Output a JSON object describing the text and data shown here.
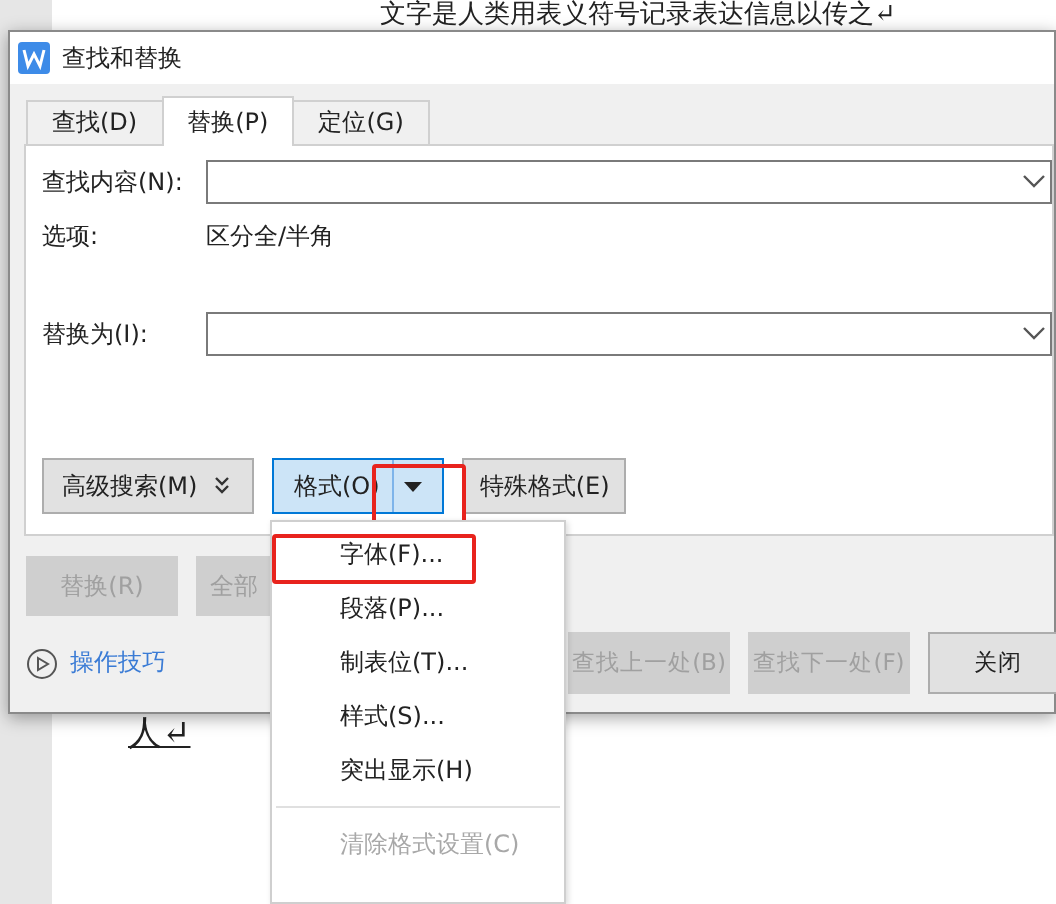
{
  "document": {
    "lines": [
      "文字是人类用表义符号记录表达信息以传之↵",
      "人↵"
    ]
  },
  "dialog": {
    "title": "查找和替换",
    "tabs": [
      {
        "label": "查找(D)",
        "selected": false
      },
      {
        "label": "替换(P)",
        "selected": true
      },
      {
        "label": "定位(G)",
        "selected": false
      }
    ],
    "find_label": "查找内容(N):",
    "options_label": "选项:",
    "options_value": "区分全/半角",
    "replace_label": "替换为(I):",
    "advanced_button": "高级搜索(M)",
    "format_button": {
      "label": "格式(O)",
      "highlighted": true,
      "expanded": true
    },
    "special_button": "特殊格式(E)",
    "action_buttons": [
      {
        "label": "替换(R)",
        "disabled": true
      },
      {
        "label": "全部",
        "disabled": true
      }
    ],
    "tips_link": "操作技巧",
    "nav_buttons": [
      {
        "label": "查找上一处(B)",
        "disabled": true
      },
      {
        "label": "查找下一处(F)",
        "disabled": true
      },
      {
        "label": "关闭",
        "disabled": false
      }
    ]
  },
  "format_menu": {
    "items": [
      {
        "label": "字体(F)...",
        "disabled": false,
        "highlighted": true
      },
      {
        "label": "段落(P)...",
        "disabled": false,
        "highlighted": false
      },
      {
        "label": "制表位(T)...",
        "disabled": false,
        "highlighted": false
      },
      {
        "label": "样式(S)...",
        "disabled": false,
        "highlighted": false
      },
      {
        "label": "突出显示(H)",
        "disabled": false,
        "highlighted": false
      },
      {
        "kind": "separator"
      },
      {
        "label": "清除格式设置(C)",
        "disabled": true,
        "highlighted": false
      }
    ]
  }
}
